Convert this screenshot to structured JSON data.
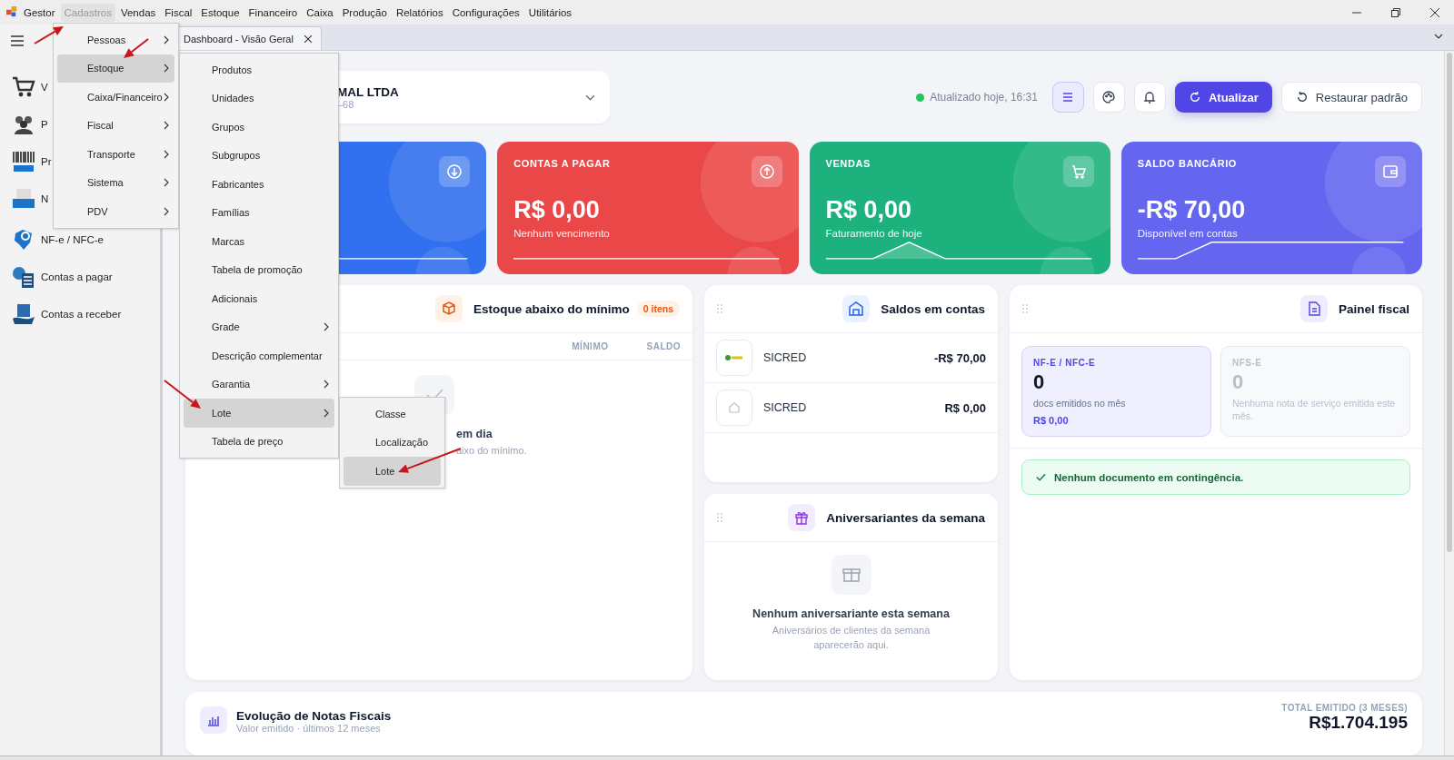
{
  "menubar": {
    "app_name": "Gestor",
    "items": [
      {
        "label": "Cadastros",
        "selected": true
      },
      {
        "label": "Vendas",
        "selected": false
      },
      {
        "label": "Fiscal",
        "selected": false
      },
      {
        "label": "Estoque",
        "selected": false
      },
      {
        "label": "Financeiro",
        "selected": false
      },
      {
        "label": "Caixa",
        "selected": false
      },
      {
        "label": "Produção",
        "selected": false
      },
      {
        "label": "Relatórios",
        "selected": false
      },
      {
        "label": "Configurações",
        "selected": false
      },
      {
        "label": "Utilitários",
        "selected": false
      }
    ]
  },
  "menus": [
    {
      "items": [
        {
          "label": "Pessoas",
          "submenu": true,
          "selected": false
        },
        {
          "label": "Estoque",
          "submenu": true,
          "selected": true
        },
        {
          "label": "Caixa/Financeiro",
          "submenu": true,
          "selected": false
        },
        {
          "label": "Fiscal",
          "submenu": true,
          "selected": false
        },
        {
          "label": "Transporte",
          "submenu": true,
          "selected": false
        },
        {
          "label": "Sistema",
          "submenu": true,
          "selected": false
        },
        {
          "label": "PDV",
          "submenu": true,
          "selected": false
        }
      ]
    },
    {
      "items": [
        {
          "label": "Produtos",
          "submenu": false,
          "selected": false
        },
        {
          "label": "Unidades",
          "submenu": false,
          "selected": false
        },
        {
          "label": "Grupos",
          "submenu": false,
          "selected": false
        },
        {
          "label": "Subgrupos",
          "submenu": false,
          "selected": false
        },
        {
          "label": "Fabricantes",
          "submenu": false,
          "selected": false
        },
        {
          "label": "Famílias",
          "submenu": false,
          "selected": false
        },
        {
          "label": "Marcas",
          "submenu": false,
          "selected": false
        },
        {
          "label": "Tabela de promoção",
          "submenu": false,
          "selected": false
        },
        {
          "label": "Adicionais",
          "submenu": false,
          "selected": false
        },
        {
          "label": "Grade",
          "submenu": true,
          "selected": false
        },
        {
          "label": "Descrição complementar",
          "submenu": false,
          "selected": false
        },
        {
          "label": "Garantia",
          "submenu": true,
          "selected": false
        },
        {
          "label": "Lote",
          "submenu": true,
          "selected": true
        },
        {
          "label": "Tabela de preço",
          "submenu": false,
          "selected": false
        }
      ]
    },
    {
      "items": [
        {
          "label": "Classe",
          "submenu": false,
          "selected": false
        },
        {
          "label": "Localização",
          "submenu": false,
          "selected": false
        },
        {
          "label": "Lote",
          "submenu": false,
          "selected": true
        }
      ]
    }
  ],
  "tab_bar": {
    "tabs": [
      {
        "label": "Dashboard - Visão Geral",
        "selected": true
      }
    ]
  },
  "sidebar": {
    "items": [
      {
        "label": "V"
      },
      {
        "label": "P"
      },
      {
        "label": "Pr"
      },
      {
        "label": "N"
      },
      {
        "label": "NF-e / NFC-e"
      },
      {
        "label": "Contas a pagar"
      },
      {
        "label": "Contas a receber"
      }
    ]
  },
  "company": {
    "name": "MAL LTDA",
    "detail": "–68"
  },
  "header": {
    "status": "Atualizado hoje, 16:31",
    "icon_buttons": [
      {
        "selected": true
      },
      {
        "selected": false
      },
      {
        "selected": false
      }
    ],
    "buttons": [
      {
        "label": "Atualizar",
        "kind": "primary"
      },
      {
        "label": "Restaurar padrão",
        "kind": "secondary"
      }
    ]
  },
  "stat_cards": [
    {
      "color": "#3170ee"
    },
    {
      "title": "CONTAS A PAGAR",
      "value": "R$ 0,00",
      "caption": "Nenhum vencimento",
      "color": "#ea4848"
    },
    {
      "title": "VENDAS",
      "value": "R$ 0,00",
      "caption": "Faturamento de hoje",
      "color": "#1db27d"
    },
    {
      "title": "SALDO BANCÁRIO",
      "value": "-R$ 70,00",
      "caption": "Disponível em contas",
      "color": "#6566f0"
    }
  ],
  "stock_panel": {
    "title": "Estoque abaixo do mínimo",
    "badge": "0 itens",
    "columns": [
      "MÍNIMO",
      "SALDO"
    ],
    "empty_title": "em dia",
    "empty_text": "aixo do mínimo."
  },
  "accounts_panel": {
    "title": "Saldos em contas",
    "rows": [
      {
        "name": "SICRED",
        "balance": "-R$ 70,00"
      },
      {
        "name": "SICRED",
        "balance": "R$ 0,00"
      }
    ]
  },
  "birthdays_panel": {
    "title": "Aniversariantes da semana",
    "empty_title": "Nenhum aniversariante esta semana",
    "empty_text": "Aniversários de clientes da semana aparecerão aqui."
  },
  "fiscal_panel": {
    "title": "Painel fiscal",
    "tiles": [
      {
        "label": "NF-E / NFC-E",
        "count": "0",
        "caption": "docs emitidos no mês",
        "amount": "R$ 0,00",
        "active": true
      },
      {
        "label": "NFS-E",
        "count": "0",
        "caption": "Nenhuma nota de serviço emitida este mês.",
        "active": false
      }
    ],
    "notice": "Nenhum documento em contingência."
  },
  "chart_card": {
    "title": "Evolução de Notas Fiscais",
    "subtitle": "Valor emitido · últimos 12 meses",
    "total_label": "TOTAL EMITIDO (3 MESES)",
    "total": "R$1.704.195"
  }
}
